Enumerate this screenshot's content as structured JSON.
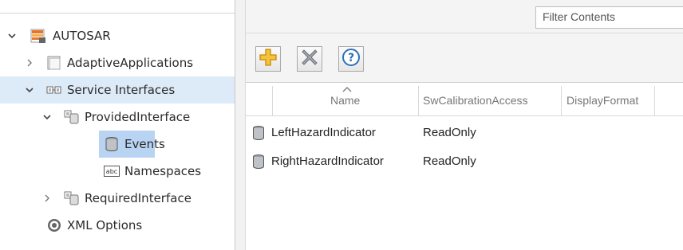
{
  "tree": {
    "items": [
      {
        "label": "AUTOSAR",
        "icon": "autosar-package-icon",
        "expander": "expanded"
      },
      {
        "label": "AdaptiveApplications",
        "icon": "application-folder-icon",
        "expander": "collapsed"
      },
      {
        "label": "Service Interfaces",
        "icon": "service-interfaces-icon",
        "expander": "expanded",
        "selected": true
      },
      {
        "label": "ProvidedInterface",
        "icon": "interface-icon",
        "expander": "expanded"
      },
      {
        "label": "Events",
        "icon": "database-icon",
        "selected": true
      },
      {
        "label": "Namespaces",
        "icon": "abc-namespace-icon"
      },
      {
        "label": "RequiredInterface",
        "icon": "interface-icon",
        "expander": "collapsed"
      },
      {
        "label": "XML Options",
        "icon": "gear-icon"
      }
    ]
  },
  "filter": {
    "placeholder": "Filter Contents"
  },
  "toolbar": {
    "buttons": [
      {
        "name": "add",
        "icon": "plus-icon",
        "color": "#f2b21b"
      },
      {
        "name": "delete",
        "icon": "x-icon",
        "color": "#8a8f98"
      },
      {
        "name": "help",
        "icon": "question-icon",
        "color": "#2f6fb5"
      }
    ]
  },
  "table": {
    "columns": [
      "Name",
      "SwCalibrationAccess",
      "DisplayFormat"
    ],
    "rows": [
      {
        "name": "LeftHazardIndicator",
        "access": "ReadOnly",
        "format": ""
      },
      {
        "name": "RightHazardIndicator",
        "access": "ReadOnly",
        "format": ""
      }
    ]
  },
  "colors": {
    "selection": "#cfe0f6",
    "accent": "#2f6fb5"
  }
}
